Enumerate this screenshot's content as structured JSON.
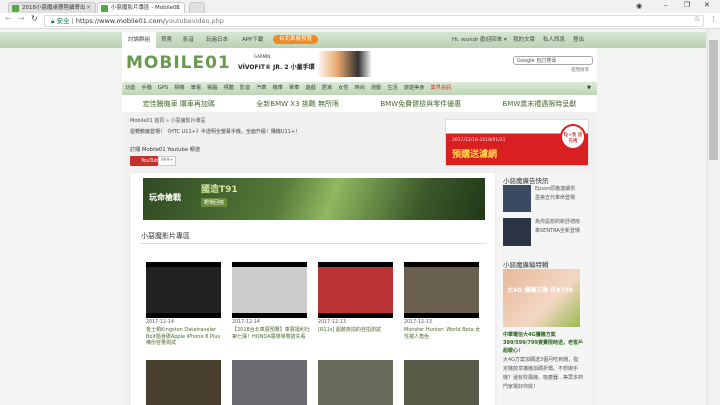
{
  "browser": {
    "tabs": [
      {
        "title": "2018小惡魔桌曆陸續寄出",
        "active": false
      },
      {
        "title": "小惡魔影片專區 - Mobile01",
        "active": true
      }
    ],
    "secure_label": "安全",
    "url_host": "https://www.mobile01.com/",
    "url_path": "youtubevideo.php",
    "window_controls": [
      "account-icon",
      "minimize-icon",
      "maximize-icon",
      "close-icon"
    ]
  },
  "topnav": {
    "items": [
      "討論群組",
      "買賣",
      "影音",
      "玩遍日本",
      "APP下載"
    ],
    "highlight": "台北車展預覽",
    "user": "Hi, wundr 歡迎回來 ▾",
    "right": [
      "我的文章",
      "私人訊息",
      "登出"
    ]
  },
  "header": {
    "logo": "MOBILE01",
    "banner_brand": "GARMIN",
    "banner_text": "VÍVOFIT® JR. 2 小童手環",
    "search_placeholder": "Google 自訂搜尋",
    "search_sub": "進階搜尋"
  },
  "categories": [
    "功能",
    "手機",
    "GPS",
    "相機",
    "筆電",
    "電腦",
    "視聽",
    "影音",
    "汽車",
    "機車",
    "單車",
    "遊戲",
    "居家",
    "女性",
    "時尚",
    "運動",
    "生活",
    "旅遊美食"
  ],
  "categories_highlight": "業界資訊",
  "promo_links": [
    "宏佳騰機車 購車再加碼",
    "全新BMW X3 挑戰 無所限",
    "BMW免費健檢與零件優惠",
    "BMW歲末禮遇限時呈獻"
  ],
  "breadcrumb": "Mobile01 首頁 » 小惡魔影片專區",
  "headline": "屋轉鏡魔登場！《HTC U11+》半透明全螢幕手機，全面升級！購機U11+！",
  "subscribe_label": "訂閱 Mobile01 Youtube 頻道",
  "youtube_button": "YouTube",
  "youtube_count": "999+",
  "ad_right": {
    "date": "2017/12/16-2018/01/21",
    "text": "預購送濾網",
    "badge": "點>我 搶先機"
  },
  "gun_ad": {
    "title": "國造T91",
    "sub": "靶場回憶",
    "brand": "玩命槍戰"
  },
  "section_title": "小惡魔影片專區",
  "videos": [
    {
      "date": "2017-12-14",
      "title": "金士頓Kingston Datatraveler Bolt隨身碟Apple iPhone 8 Plus備份容量測試"
    },
    {
      "date": "2017-12-14",
      "title": "【2018台北車展預覽】車展福利社第七彈！HONDA展場導覽搶先看"
    },
    {
      "date": "2017-12-13",
      "title": "[R11s] 超越夜拍的自拍測試"
    },
    {
      "date": "2017-12-13",
      "title": "Monster Hunter: World Beta 女性獵人角色"
    }
  ],
  "sidebar": {
    "ads_title": "小惡魔廣告快訊",
    "ads": [
      "Epson原廠連續供墨第五代革命登場",
      "為你設想的新舒適房車SENTRA全新登場"
    ],
    "feature_title": "小惡魔廣編特輯",
    "feature_img": "大4G 攜機方案 月$799",
    "feature_headline": "中華電信大4G攜機方案 399/599/799資費限時送，老客戶超暖心！",
    "feature_body": "大4G方案加碼送3個月吃到飽，指定機款享攜機加碼折價。不想綁手機？還有吹風機、吸塵器…等眾多熱門家電好你挑！"
  }
}
